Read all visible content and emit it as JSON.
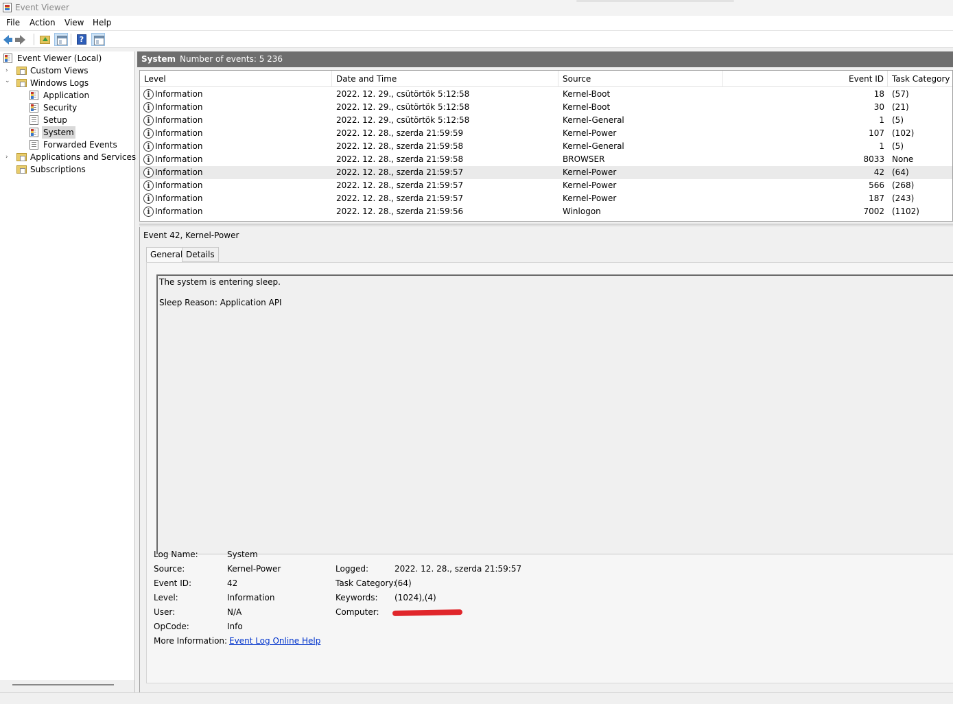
{
  "window": {
    "title": "Event Viewer"
  },
  "menu": [
    "File",
    "Action",
    "View",
    "Help"
  ],
  "toolbar": {
    "back_icon": "arrow-left-icon",
    "forward_icon": "arrow-right-icon",
    "up_icon": "folder-up-icon",
    "show_hide_icon": "console-tree-icon",
    "help_icon": "help-icon",
    "help_glyph": "?",
    "action_pane_icon": "action-pane-icon"
  },
  "tree": {
    "root": "Event Viewer (Local)",
    "custom_views": "Custom Views",
    "windows_logs": "Windows Logs",
    "application": "Application",
    "security": "Security",
    "setup": "Setup",
    "system": "System",
    "forwarded": "Forwarded Events",
    "apps_services": "Applications and Services Lo",
    "subscriptions": "Subscriptions",
    "chev_collapsed": "›",
    "chev_expanded": "⌄"
  },
  "header": {
    "title": "System",
    "count": "Number of events: 5 236"
  },
  "columns": {
    "level": "Level",
    "datetime": "Date and Time",
    "source": "Source",
    "eventid": "Event ID",
    "category": "Task Category"
  },
  "info_glyph": "i",
  "events": [
    {
      "level": "Information",
      "datetime": "2022. 12. 29., csütörtök 5:12:58",
      "source": "Kernel-Boot",
      "eventid": "18",
      "category": "(57)"
    },
    {
      "level": "Information",
      "datetime": "2022. 12. 29., csütörtök 5:12:58",
      "source": "Kernel-Boot",
      "eventid": "30",
      "category": "(21)"
    },
    {
      "level": "Information",
      "datetime": "2022. 12. 29., csütörtök 5:12:58",
      "source": "Kernel-General",
      "eventid": "1",
      "category": "(5)"
    },
    {
      "level": "Information",
      "datetime": "2022. 12. 28., szerda 21:59:59",
      "source": "Kernel-Power",
      "eventid": "107",
      "category": "(102)"
    },
    {
      "level": "Information",
      "datetime": "2022. 12. 28., szerda 21:59:58",
      "source": "Kernel-General",
      "eventid": "1",
      "category": "(5)"
    },
    {
      "level": "Information",
      "datetime": "2022. 12. 28., szerda 21:59:58",
      "source": "BROWSER",
      "eventid": "8033",
      "category": "None"
    },
    {
      "level": "Information",
      "datetime": "2022. 12. 28., szerda 21:59:57",
      "source": "Kernel-Power",
      "eventid": "42",
      "category": "(64)"
    },
    {
      "level": "Information",
      "datetime": "2022. 12. 28., szerda 21:59:57",
      "source": "Kernel-Power",
      "eventid": "566",
      "category": "(268)"
    },
    {
      "level": "Information",
      "datetime": "2022. 12. 28., szerda 21:59:57",
      "source": "Kernel-Power",
      "eventid": "187",
      "category": "(243)"
    },
    {
      "level": "Information",
      "datetime": "2022. 12. 28., szerda 21:59:56",
      "source": "Winlogon",
      "eventid": "7002",
      "category": "(1102)"
    }
  ],
  "detail": {
    "title": "Event 42, Kernel-Power",
    "tab_general": "General",
    "tab_details": "Details",
    "description_line1": "The system is entering sleep.",
    "description_line2": "Sleep Reason: Application API",
    "labels": {
      "log_name": "Log Name:",
      "source": "Source:",
      "event_id": "Event ID:",
      "level": "Level:",
      "user": "User:",
      "opcode": "OpCode:",
      "more_info": "More Information:",
      "logged": "Logged:",
      "task_category": "Task Category:",
      "keywords": "Keywords:",
      "computer": "Computer:"
    },
    "values": {
      "log_name": "System",
      "source": "Kernel-Power",
      "event_id": "42",
      "level": "Information",
      "user": "N/A",
      "opcode": "Info",
      "more_info_link": "Event Log Online Help",
      "logged": "2022. 12. 28., szerda 21:59:57",
      "task_category": "(64)",
      "keywords": "(1024),(4)"
    },
    "redaction_color": "#e0262b"
  }
}
